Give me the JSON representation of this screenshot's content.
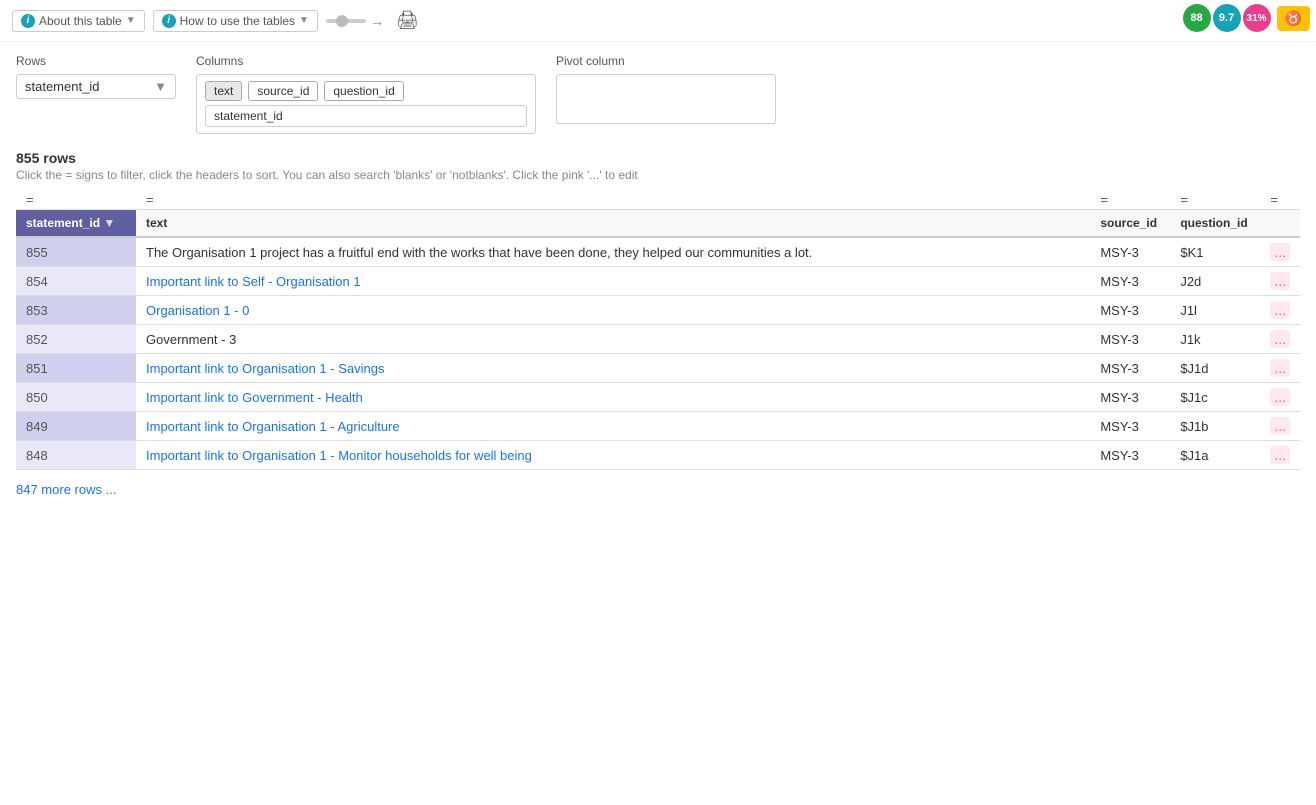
{
  "topbar": {
    "about_btn": "About this table",
    "howto_btn": "How to use the tables",
    "info_icon": "i"
  },
  "badges": {
    "green": "88",
    "teal": "9.7",
    "pink": "31%",
    "user_icon": "♉"
  },
  "config": {
    "rows_label": "Rows",
    "rows_value": "statement_id",
    "columns_label": "Columns",
    "column_tags": [
      "text",
      "source_id",
      "question_id"
    ],
    "column_row2": "statement_id",
    "pivot_label": "Pivot column",
    "pivot_value": ""
  },
  "table_info": {
    "row_count": "855 rows",
    "hint": "Click the = signs to filter, click the headers to sort. You can also search 'blanks' or 'notblanks'. Click the pink '...' to edit"
  },
  "table": {
    "filter_symbol": "=",
    "columns": [
      {
        "key": "statement_id",
        "label": "statement_id",
        "has_arrow": true
      },
      {
        "key": "text",
        "label": "text"
      },
      {
        "key": "source_id",
        "label": "source_id"
      },
      {
        "key": "question_id",
        "label": "question_id"
      }
    ],
    "rows": [
      {
        "id": 855,
        "text": "The Organisation 1 project has a fruitful end with the works that have been done, they helped our communities a lot.",
        "source_id": "MSY-3",
        "question_id": "$K1",
        "is_link": false
      },
      {
        "id": 854,
        "text": "Important link to Self - Organisation 1",
        "source_id": "MSY-3",
        "question_id": "J2d",
        "is_link": true
      },
      {
        "id": 853,
        "text": "Organisation 1 - 0",
        "source_id": "MSY-3",
        "question_id": "J1l",
        "is_link": true
      },
      {
        "id": 852,
        "text": "Government - 3",
        "source_id": "MSY-3",
        "question_id": "J1k",
        "is_link": false
      },
      {
        "id": 851,
        "text": "Important link to Organisation 1 - Savings",
        "source_id": "MSY-3",
        "question_id": "$J1d",
        "is_link": true
      },
      {
        "id": 850,
        "text": "Important link to Government - Health",
        "source_id": "MSY-3",
        "question_id": "$J1c",
        "is_link": true
      },
      {
        "id": 849,
        "text": "Important link to Organisation 1 - Agriculture",
        "source_id": "MSY-3",
        "question_id": "$J1b",
        "is_link": true
      },
      {
        "id": 848,
        "text": "Important link to Organisation 1 - Monitor households for well being",
        "source_id": "MSY-3",
        "question_id": "$J1a",
        "is_link": true
      }
    ]
  },
  "footer": {
    "more_rows": "847 more rows ..."
  }
}
